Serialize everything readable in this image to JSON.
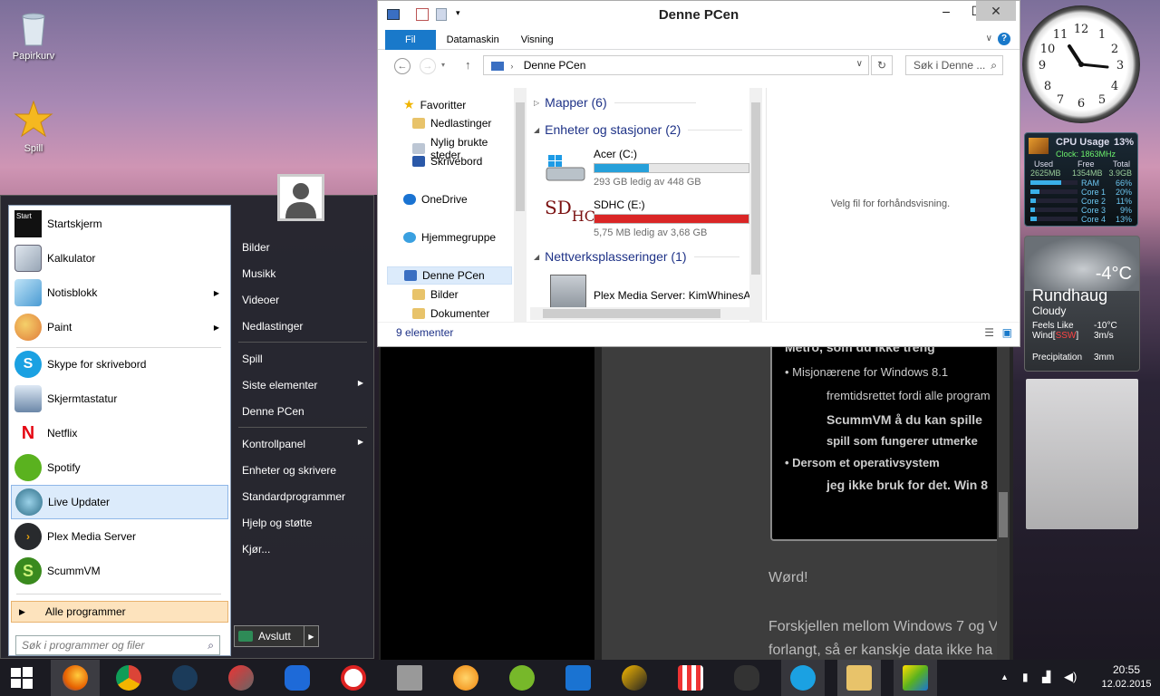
{
  "desktop": {
    "icons": [
      {
        "label": "Papirkurv"
      },
      {
        "label": "Spill"
      }
    ]
  },
  "start_menu": {
    "programs": [
      {
        "label": "Startskjerm",
        "icon": "startscreen-icon",
        "badge": "Start"
      },
      {
        "label": "Kalkulator",
        "icon": "calculator-icon"
      },
      {
        "label": "Notisblokk",
        "icon": "notepad-icon"
      },
      {
        "label": "Paint",
        "icon": "paint-icon"
      },
      {
        "label": "Skype for skrivebord",
        "icon": "skype-icon"
      },
      {
        "label": "Skjermtastatur",
        "icon": "keyboard-icon"
      },
      {
        "label": "Netflix",
        "icon": "netflix-icon"
      },
      {
        "label": "Spotify",
        "icon": "spotify-icon"
      },
      {
        "label": "Live Updater",
        "icon": "live-updater-icon"
      },
      {
        "label": "Plex Media Server",
        "icon": "plex-icon"
      },
      {
        "label": "ScummVM",
        "icon": "scummvm-icon"
      }
    ],
    "all_programs": "Alle programmer",
    "search_placeholder": "Søk i programmer og filer",
    "right_items": {
      "bilder": "Bilder",
      "musikk": "Musikk",
      "videoer": "Videoer",
      "nedlastinger": "Nedlastinger",
      "spill": "Spill",
      "siste": "Siste elementer",
      "denne_pc": "Denne PCen",
      "kontrollpanel": "Kontrollpanel",
      "enheter": "Enheter og skrivere",
      "standard": "Standardprogrammer",
      "hjelp": "Hjelp og støtte",
      "kjor": "Kjør..."
    },
    "shutdown": "Avslutt"
  },
  "explorer": {
    "title": "Denne PCen",
    "tabs": [
      "Fil",
      "Datamaskin",
      "Visning"
    ],
    "address": "Denne PCen",
    "search_placeholder": "Søk i Denne ...",
    "nav": {
      "favoritter": "Favoritter",
      "nedlastinger": "Nedlastinger",
      "nylig": "Nylig brukte steder",
      "skrivebord": "Skrivebord",
      "onedrive": "OneDrive",
      "hjemmegruppe": "Hjemmegruppe",
      "denne_pc": "Denne PCen",
      "bilder": "Bilder",
      "dokumenter": "Dokumenter"
    },
    "groups": {
      "mapper": "Mapper (6)",
      "enheter": "Enheter og stasjoner (2)",
      "nettverk": "Nettverksplasseringer (1)"
    },
    "drives": [
      {
        "name": "Acer (C:)",
        "free": "293 GB ledig av 448 GB",
        "used_fraction": 0.35,
        "color": "#26a0da"
      },
      {
        "name": "SDHC (E:)",
        "free": "5,75 MB ledig av 3,68 GB",
        "used_fraction": 0.998,
        "color": "#da2626"
      }
    ],
    "network_item": "Plex Media Server: KimWhinesAl",
    "preview_text": "Velg fil for forhåndsvisning.",
    "status": "9 elementer"
  },
  "browser": {
    "box_lines": [
      "Metro, som du ikke treng",
      "• Misjonærene for Windows 8.1",
      "fremtidsrettet fordi alle program",
      "ScummVM å du kan spille",
      "spill som fungerer utmerke",
      "• Dersom et operativsystem",
      "jeg ikke bruk for det. Win 8"
    ],
    "text1": "Wørd!",
    "text2": "Forskjellen mellom Windows 7 og V",
    "text3": "forlangt, så er kanskje data ikke ha"
  },
  "gadgets": {
    "cpu": {
      "title": "CPU Usage",
      "percent": "13%",
      "clock": "Clock: 1863MHz",
      "used_label": "Used",
      "free_label": "Free",
      "total_label": "Total",
      "used": "2625MB",
      "free": "1354MB",
      "total": "3.9GB",
      "rows": [
        {
          "label": "RAM",
          "value": "66%",
          "level": 0.66
        },
        {
          "label": "Core 1",
          "value": "20%",
          "level": 0.2
        },
        {
          "label": "Core 2",
          "value": "11%",
          "level": 0.11
        },
        {
          "label": "Core 3",
          "value": "9%",
          "level": 0.09
        },
        {
          "label": "Core 4",
          "value": "13%",
          "level": 0.13
        }
      ]
    },
    "weather": {
      "temp": "-4°C",
      "city": "Rundhaug",
      "cond": "Cloudy",
      "feels_label": "Feels Like",
      "feels": "-10°C",
      "wind_label": "Wind",
      "wind_dir": "SSW",
      "wind": "3m/s",
      "precip_label": "Precipitation",
      "precip": "3mm"
    }
  },
  "tray": {
    "time": "20:55",
    "date": "12.02.2015"
  }
}
